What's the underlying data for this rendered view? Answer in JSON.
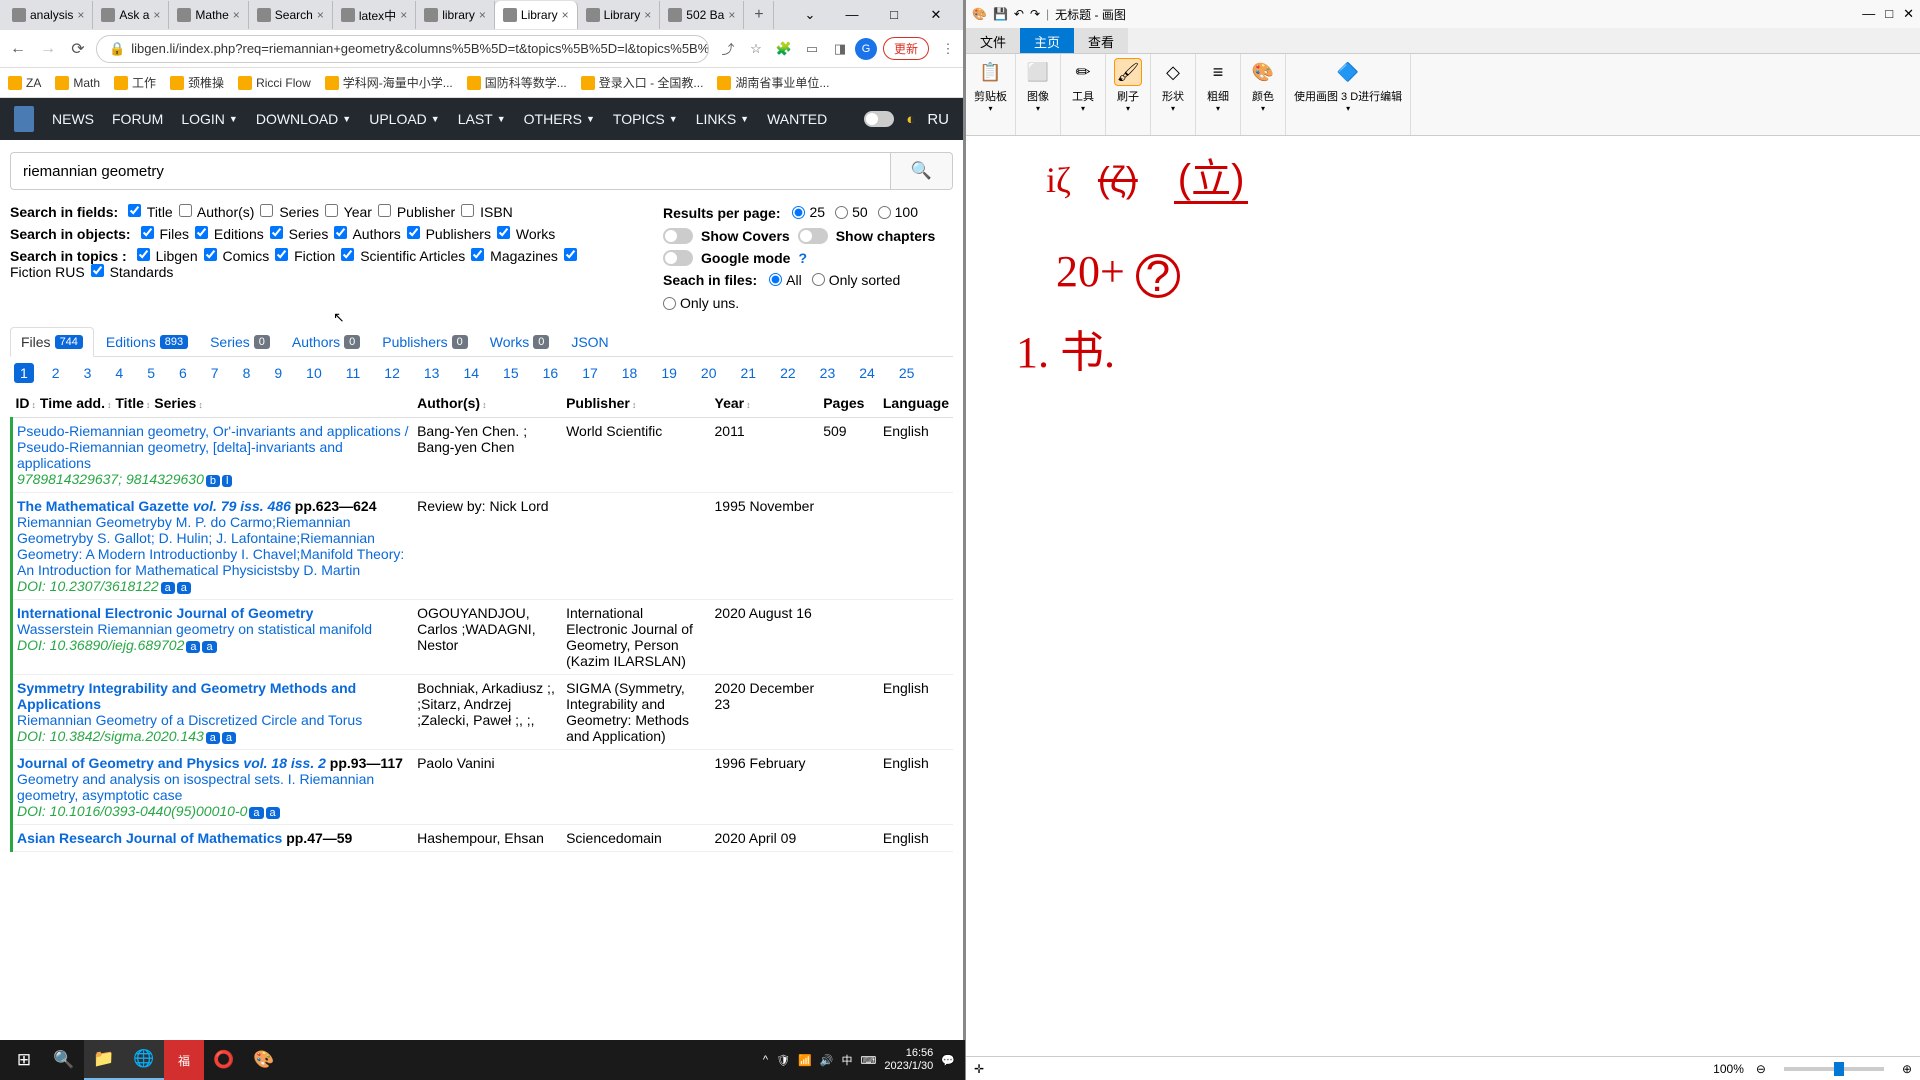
{
  "browser": {
    "tabs": [
      {
        "label": "analysis",
        "active": false
      },
      {
        "label": "Ask a",
        "active": false
      },
      {
        "label": "Mathe",
        "active": false
      },
      {
        "label": "Search",
        "active": false
      },
      {
        "label": "latex中",
        "active": false
      },
      {
        "label": "library",
        "active": false
      },
      {
        "label": "Library",
        "active": true
      },
      {
        "label": "Library",
        "active": false
      },
      {
        "label": "502 Ba",
        "active": false
      }
    ],
    "url": "libgen.li/index.php?req=riemannian+geometry&columns%5B%5D=t&topics%5B%5D=l&topics%5B%5D=c&topics%5B%5D...",
    "update_btn": "更新",
    "bookmarks": [
      "ZA",
      "Math",
      "工作",
      "颈椎操",
      "Ricci Flow",
      "学科网-海量中小学...",
      "国防科等数学...",
      "登录入口 - 全国教...",
      "湖南省事业单位..."
    ]
  },
  "nav": {
    "items": [
      "NEWS",
      "FORUM",
      "LOGIN",
      "DOWNLOAD",
      "UPLOAD",
      "LAST",
      "OTHERS",
      "TOPICS",
      "LINKS",
      "WANTED"
    ],
    "lang": "RU"
  },
  "search": {
    "value": "riemannian geometry"
  },
  "fields": {
    "label": "Search in fields:",
    "items": [
      {
        "label": "Title",
        "ck": true
      },
      {
        "label": "Author(s)",
        "ck": false
      },
      {
        "label": "Series",
        "ck": false
      },
      {
        "label": "Year",
        "ck": false
      },
      {
        "label": "Publisher",
        "ck": false
      },
      {
        "label": "ISBN",
        "ck": false
      }
    ]
  },
  "objects": {
    "label": "Search in objects:",
    "items": [
      {
        "label": "Files",
        "ck": true
      },
      {
        "label": "Editions",
        "ck": true
      },
      {
        "label": "Series",
        "ck": true
      },
      {
        "label": "Authors",
        "ck": true
      },
      {
        "label": "Publishers",
        "ck": true
      },
      {
        "label": "Works",
        "ck": true
      }
    ]
  },
  "topics": {
    "label": "Search in topics :",
    "items": [
      {
        "label": "Libgen",
        "ck": true
      },
      {
        "label": "Comics",
        "ck": true
      },
      {
        "label": "Fiction",
        "ck": true
      },
      {
        "label": "Scientific Articles",
        "ck": true
      },
      {
        "label": "Magazines",
        "ck": true
      },
      {
        "label": "Fiction RUS",
        "ck": true
      },
      {
        "label": "Standards",
        "ck": true
      }
    ]
  },
  "right_opts": {
    "rpp_label": "Results per page:",
    "rpp": [
      {
        "v": "25",
        "on": true
      },
      {
        "v": "50",
        "on": false
      },
      {
        "v": "100",
        "on": false
      }
    ],
    "show_covers": "Show Covers",
    "show_chapters": "Show chapters",
    "google": "Google mode",
    "q": "?",
    "files_label": "Seach in files:",
    "files": [
      {
        "v": "All",
        "on": true
      },
      {
        "v": "Only sorted",
        "on": false
      },
      {
        "v": "Only uns.",
        "on": false
      }
    ]
  },
  "result_tabs": [
    {
      "label": "Files",
      "count": "744",
      "active": true
    },
    {
      "label": "Editions",
      "count": "893",
      "active": false
    },
    {
      "label": "Series",
      "count": "0",
      "active": false
    },
    {
      "label": "Authors",
      "count": "0",
      "active": false
    },
    {
      "label": "Publishers",
      "count": "0",
      "active": false
    },
    {
      "label": "Works",
      "count": "0",
      "active": false
    },
    {
      "label": "JSON",
      "count": null,
      "active": false
    }
  ],
  "pages": [
    "1",
    "2",
    "3",
    "4",
    "5",
    "6",
    "7",
    "8",
    "9",
    "10",
    "11",
    "12",
    "13",
    "14",
    "15",
    "16",
    "17",
    "18",
    "19",
    "20",
    "21",
    "22",
    "23",
    "24",
    "25"
  ],
  "headers": {
    "id": "ID",
    "time": "Time add.",
    "title": "Title",
    "series": "Series",
    "authors": "Author(s)",
    "publisher": "Publisher",
    "year": "Year",
    "pages": "Pages",
    "lang": "Language"
  },
  "rows": [
    {
      "title": "Pseudo-Riemannian geometry, Or'-invariants and applications / Pseudo-Riemannian geometry, [delta]-invariants and applications",
      "isbn": "9789814329637; 9814329630",
      "badges": [
        "b",
        "l"
      ],
      "authors": "Bang-Yen Chen. ; Bang-yen Chen",
      "publisher": "World Scientific",
      "year": "2011",
      "pages": "509",
      "lang": "English"
    },
    {
      "series": "The Mathematical Gazette",
      "vol": "vol. 79 iss. 486",
      "pp": "pp.623—624",
      "title": "Riemannian Geometryby M. P. do Carmo;Riemannian Geometryby S. Gallot; D. Hulin; J. Lafontaine;Riemannian Geometry: A Modern Introductionby I. Chavel;Manifold Theory: An Introduction for Mathematical Physicistsby D. Martin",
      "isbn": "DOI: 10.2307/3618122",
      "badges": [
        "a",
        "a"
      ],
      "authors": "Review by: Nick Lord",
      "publisher": "",
      "year": "1995 November",
      "pages": "",
      "lang": ""
    },
    {
      "series": "International Electronic Journal of Geometry",
      "vol": "",
      "pp": "",
      "title": "Wasserstein Riemannian geometry on statistical manifold",
      "isbn": "DOI: 10.36890/iejg.689702",
      "badges": [
        "a",
        "a"
      ],
      "authors": "OGOUYANDJOU, Carlos ;WADAGNI, Nestor",
      "publisher": "International Electronic Journal of Geometry, Person (Kazim ILARSLAN)",
      "year": "2020 August 16",
      "pages": "",
      "lang": ""
    },
    {
      "series": "Symmetry Integrability and Geometry Methods and Applications",
      "vol": "",
      "pp": "",
      "title": "Riemannian Geometry of a Discretized Circle and Torus",
      "isbn": "DOI: 10.3842/sigma.2020.143",
      "badges": [
        "a",
        "a"
      ],
      "authors": "Bochniak, Arkadiusz ;, ;Sitarz, Andrzej ;Zalecki, Paweł ;, ;,",
      "publisher": "SIGMA (Symmetry, Integrability and Geometry: Methods and Application)",
      "year": "2020 December 23",
      "pages": "",
      "lang": "English"
    },
    {
      "series": "Journal of Geometry and Physics",
      "vol": "vol. 18 iss. 2",
      "pp": "pp.93—117",
      "title": "Geometry and analysis on isospectral sets. I. Riemannian geometry, asymptotic case",
      "isbn": "DOI: 10.1016/0393-0440(95)00010-0",
      "badges": [
        "a",
        "a"
      ],
      "authors": "Paolo Vanini",
      "publisher": "",
      "year": "1996 February",
      "pages": "",
      "lang": "English"
    },
    {
      "series": "Asian Research Journal of Mathematics",
      "vol": "",
      "pp": "pp.47—59",
      "title": "",
      "isbn": "",
      "badges": [],
      "authors": "Hashempour, Ehsan",
      "publisher": "Sciencedomain",
      "year": "2020 April 09",
      "pages": "",
      "lang": "English"
    }
  ],
  "paint": {
    "title": "无标题 - 画图",
    "tabs": [
      "文件",
      "主页",
      "查看"
    ],
    "ribbon": [
      {
        "icon": "📋",
        "label": "剪贴板"
      },
      {
        "icon": "⬜",
        "label": "图像"
      },
      {
        "icon": "✏",
        "label": "工具"
      },
      {
        "icon": "🖌",
        "label": "刷子",
        "hl": true
      },
      {
        "icon": "◇",
        "label": "形状"
      },
      {
        "icon": "≡",
        "label": "粗细"
      },
      {
        "icon": "🎨",
        "label": "颜色"
      },
      {
        "icon": "🔷",
        "label": "使用画图 3 D进行编辑"
      }
    ],
    "zoom": "100%"
  },
  "tray": {
    "time": "16:56",
    "date": "2023/1/30"
  }
}
